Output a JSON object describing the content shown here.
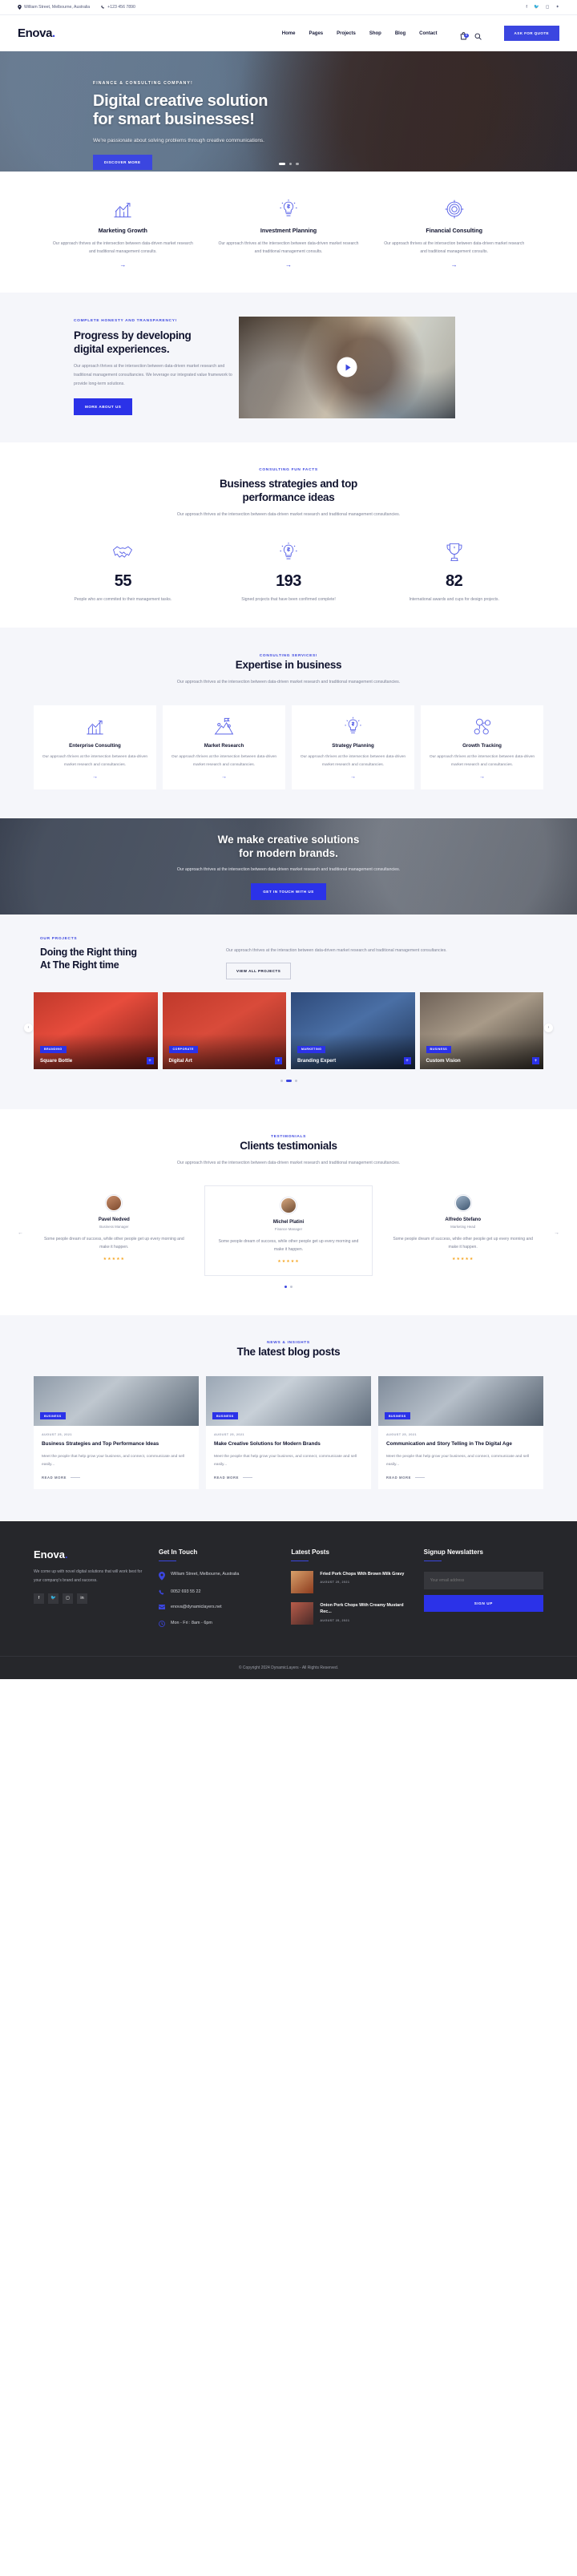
{
  "topbar": {
    "address": "William Street, Melbourne, Australia",
    "phone": "+123 456 7890",
    "social": [
      "f",
      "t",
      "ig",
      "be"
    ]
  },
  "header": {
    "logo": "Enova",
    "logo_dot": ".",
    "nav": [
      "Home",
      "Pages",
      "Projects",
      "Shop",
      "Blog",
      "Contact"
    ],
    "cart_count": "0",
    "cta": "ASK FOR QUOTE"
  },
  "hero": {
    "kicker": "FINANCE & CONSULTING COMPANY!",
    "title_line1": "Digital creative solution",
    "title_line2": "for smart businesses!",
    "paragraph": "We're passionate about solving problems through creative communications.",
    "button": "DISCOVER MORE"
  },
  "services": [
    {
      "title": "Marketing Growth",
      "text": "Our approach thrives at the intersection between data-driven market research and traditional management consults.",
      "icon": "bar-chart-growth-icon"
    },
    {
      "title": "Investment Planning",
      "text": "Our approach thrives at the intersection between data-driven market research and traditional management consults.",
      "icon": "lightbulb-dollar-icon"
    },
    {
      "title": "Financial Consulting",
      "text": "Our approach thrives at the intersection between data-driven market research and traditional management consults.",
      "icon": "target-dollar-icon"
    }
  ],
  "progress": {
    "kicker": "COMPLETE HONESTY AND TRANSPARENCY!",
    "title_line1": "Progress by developing",
    "title_line2": "digital experiences.",
    "paragraph": "Our approach thrives at the intersection between data-driven market research and traditional management consultancies. We leverage our integrated value framework to provide long-term solutions.",
    "button": "MORE ABOUT US"
  },
  "facts": {
    "kicker": "CONSULTING FUN FACTS",
    "title_line1": "Business strategies and top",
    "title_line2": "performance ideas",
    "subtitle": "Our approach thrives at the intersection between data-driven market research and traditional management consultancies.",
    "counters": [
      {
        "number": "55",
        "label": "People who are commited to their management tasks.",
        "icon": "handshake-icon"
      },
      {
        "number": "193",
        "label": "Signed projects that have been confirmed complete!",
        "icon": "lightbulb-dollar-icon"
      },
      {
        "number": "82",
        "label": "International awards and cups for design projects.",
        "icon": "trophy-icon"
      }
    ]
  },
  "expertise": {
    "kicker": "CONSULTING SERVICES!",
    "title": "Expertise in business",
    "subtitle": "Our approach thrives at the intersection between data-driven market research and traditional management consultancies.",
    "cards": [
      {
        "title": "Enterprise Consulting",
        "text": "Our approach thrives at the intersection between data-driven market research and consultancies.",
        "icon": "bar-chart-growth-icon"
      },
      {
        "title": "Market Research",
        "text": "Our approach thrives at the intersection between data-driven market research and consultancies.",
        "icon": "mountain-flag-icon"
      },
      {
        "title": "Strategy Planning",
        "text": "Our approach thrives at the intersection between data-driven market research and consultancies.",
        "icon": "lightbulb-dollar-icon"
      },
      {
        "title": "Growth Tracking",
        "text": "Our approach thrives at the intersection between data-driven market research and consultancies.",
        "icon": "network-dollar-icon"
      }
    ]
  },
  "cta": {
    "title_line1": "We make creative solutions",
    "title_line2": "for modern brands.",
    "paragraph": "Our approach thrives at the intersection between data-driven market research and traditional management consultancies.",
    "button": "GET IN TOUCH WITH US"
  },
  "projects": {
    "kicker": "OUR PROJECTS",
    "title_line1": "Doing the Right thing",
    "title_line2": "At The Right time",
    "paragraph": "Our approach thrives at the interaction between data-driven market research and traditional management consultancies.",
    "button": "VIEW ALL PROJECTS",
    "items": [
      {
        "tag": "BRANDING",
        "title": "Square Bottle"
      },
      {
        "tag": "CORPORATE",
        "title": "Digital Art"
      },
      {
        "tag": "MARKETING",
        "title": "Branding Expert"
      },
      {
        "tag": "BUSINESS",
        "title": "Custom Vision"
      }
    ]
  },
  "testimonials": {
    "kicker": "TESTIMONIALS",
    "title": "Clients testimonials",
    "subtitle": "Our approach thrives at the intersection between data-driven market research and traditional management consultancies.",
    "items": [
      {
        "name": "Pavel Nedved",
        "role": "Business Manager",
        "text": "Some people dream of success, while other people get up every morning and make it happen.",
        "stars": "★★★★★"
      },
      {
        "name": "Michel Platini",
        "role": "Finance Manager",
        "text": "Some people dream of success, while other people get up every morning and make it happen.",
        "stars": "★★★★★"
      },
      {
        "name": "Alfredo Stefano",
        "role": "Marketing Head",
        "text": "Some people dream of success, while other people get up every morning and make it happen.",
        "stars": "★★★★★"
      }
    ]
  },
  "blog": {
    "kicker": "NEWS & INSIGHTS",
    "title": "The latest blog posts",
    "posts": [
      {
        "tag": "BUSINESS",
        "date": "AUGUST 25, 2021",
        "title": "Business Strategies and Top Performance Ideas",
        "text": "Meet the people that help grow your business, and connect, communicate and sell easily...",
        "readmore": "READ MORE"
      },
      {
        "tag": "BUSINESS",
        "date": "AUGUST 25, 2021",
        "title": "Make Creative Solutions for Modern Brands",
        "text": "Meet the people that help grow your business, and connect, communicate and sell easily...",
        "readmore": "READ MORE"
      },
      {
        "tag": "BUSINESS",
        "date": "AUGUST 25, 2021",
        "title": "Communication and Story Telling in The Digital Age",
        "text": "Meet the people that help grow your business, and connect, communicate and sell easily...",
        "readmore": "READ MORE"
      }
    ]
  },
  "footer": {
    "logo": "Enova",
    "logo_dot": ".",
    "about": "We come up with novel digital solutions that will work best for your company's brand and success.",
    "social": [
      "f",
      "t",
      "ig",
      "in"
    ],
    "contact_heading": "Get In Touch",
    "contact": [
      {
        "icon": "location-pin-icon",
        "text": "William Street, Melbourne, Australia"
      },
      {
        "icon": "phone-icon",
        "text": "0052 693 55 22"
      },
      {
        "icon": "envelope-icon",
        "text": "enova@dynamiclayers.net"
      },
      {
        "icon": "clock-icon",
        "text": "Mon - Fri : 8am - 6pm"
      }
    ],
    "posts_heading": "Latest Posts",
    "posts": [
      {
        "title": "Fried Pork Chops With Brown Milk Gravy",
        "date": "AUGUST 25, 2021"
      },
      {
        "title": "Onion Pork Chops With Creamy Mustard Rec...",
        "date": "AUGUST 25, 2021"
      }
    ],
    "newsletter_heading": "Signup Newslatters",
    "newsletter_placeholder": "Your email address",
    "newsletter_button": "SIGN UP",
    "copyright": "© Copyright 2024 DynamicLayers - All Rights Reserved."
  },
  "colors": {
    "accent": "#3b46e0",
    "accent_dark": "#2b32e8",
    "ink": "#10132e",
    "muted": "#7d8296"
  }
}
